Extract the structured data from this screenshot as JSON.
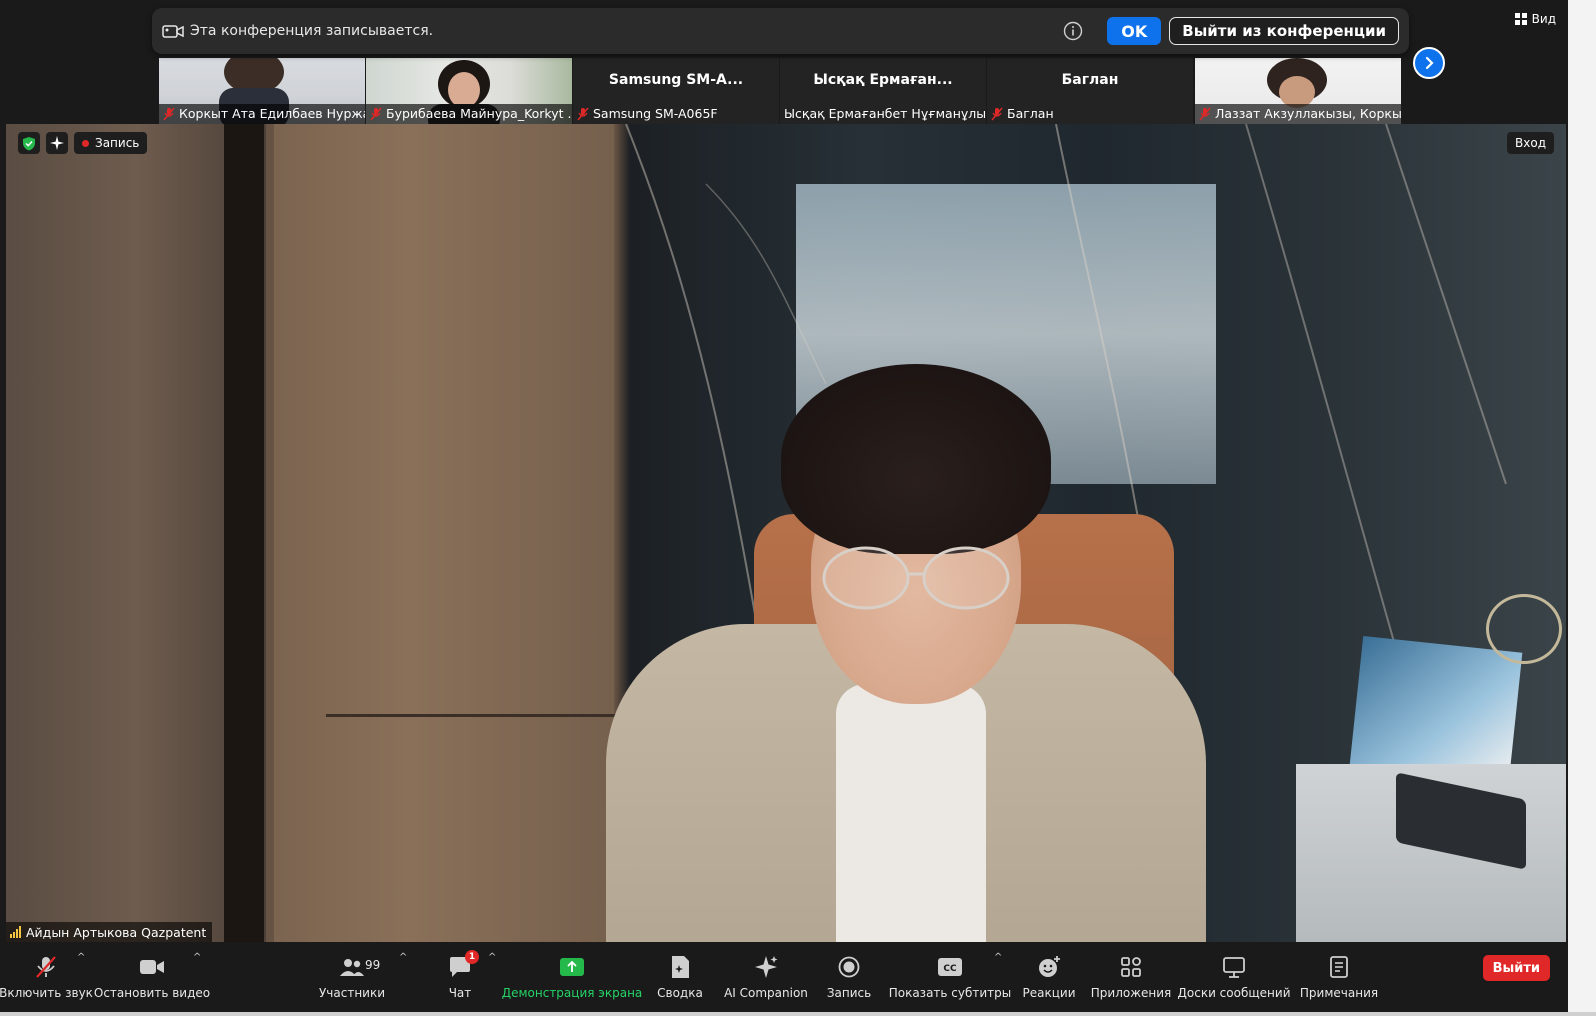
{
  "banner": {
    "text": "Эта конференция записывается.",
    "ok_label": "OK",
    "leave_label": "Выйти из конференции"
  },
  "view_label": "Вид",
  "gallery": [
    {
      "name": "",
      "label": "Коркыт Ата Едилбаев Нуржан",
      "muted": true
    },
    {
      "name": "",
      "label": "Бурибаева Майнура_Korkyt ...",
      "muted": true
    },
    {
      "name": "Samsung  SM-A...",
      "label": "Samsung SM-A065F",
      "muted": true
    },
    {
      "name": "Ысқақ Ермаған...",
      "label": "Ысқақ Ермағанбет Нұғманұлы",
      "muted": false
    },
    {
      "name": "Баглан",
      "label": "Баглан",
      "muted": true
    },
    {
      "name": "",
      "label": "Лаззат Акзуллакызы, Коркыт...",
      "muted": true
    }
  ],
  "main": {
    "record_label": "Запись",
    "enter_label": "Вход",
    "speaker": "Айдын Артыкова Qazpatent"
  },
  "toolbar": {
    "unmute": "Включить звук",
    "stop_video": "Остановить видео",
    "participants": "Участники",
    "participants_count": "99",
    "chat": "Чат",
    "chat_badge": "1",
    "share": "Демонстрация экрана",
    "summary": "Сводка",
    "ai": "AI Companion",
    "record": "Запись",
    "captions": "Показать субтитры",
    "reactions": "Реакции",
    "apps": "Приложения",
    "boards": "Доски сообщений",
    "notes": "Примечания",
    "exit": "Выйти"
  },
  "colors": {
    "accent": "#0e72ed",
    "danger": "#e02828",
    "share_green": "#25d366"
  }
}
